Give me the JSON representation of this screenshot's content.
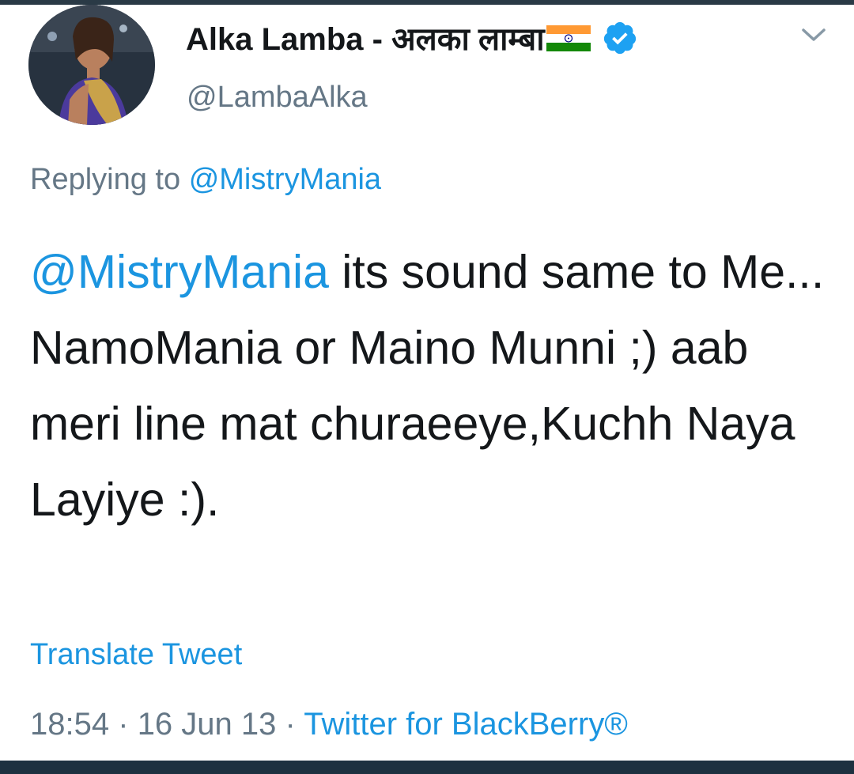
{
  "author": {
    "display_name": "Alka Lamba - अलका लाम्बा",
    "handle": "@LambaAlka",
    "avatar_icon": "profile-photo",
    "flag_icon": "india-flag-icon",
    "verified_icon": "verified-badge-icon"
  },
  "reply": {
    "prefix": "Replying to",
    "target": "@MistryMania"
  },
  "tweet": {
    "mention": "@MistryMania",
    "body": " its sound same to Me... NamoMania or Maino Munni ;) aab meri line mat churaeeye,Kuchh Naya Layiye :)."
  },
  "actions": {
    "translate_label": "Translate Tweet",
    "more_icon": "chevron-down-icon"
  },
  "meta": {
    "time": "18:54",
    "separator": "·",
    "date": "16 Jun 13",
    "source": "Twitter for BlackBerry®"
  },
  "colors": {
    "link": "#1b95e0",
    "text": "#14171a",
    "muted": "#657786",
    "verified": "#1da1f2",
    "background": "#ffffff"
  }
}
